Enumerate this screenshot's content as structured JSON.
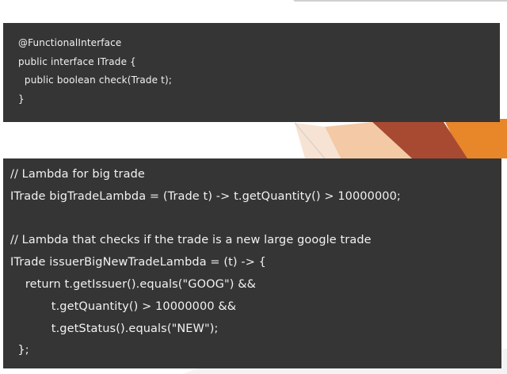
{
  "snippet_interface": {
    "lines": [
      "@FunctionalInterface",
      "public interface ITrade {",
      "  public boolean check(Trade t);",
      "}"
    ]
  },
  "snippet_lambdas": {
    "lines": [
      "// Lambda for big trade",
      "ITrade bigTradeLambda = (Trade t) -> t.getQuantity() > 10000000;",
      "",
      "// Lambda that checks if the trade is a new large google trade",
      "ITrade issuerBigNewTradeLambda = (t) -> {",
      "    return t.getIssuer().equals(\"GOOG\") &&",
      "           t.getQuantity() > 10000000 &&",
      "           t.getStatus().equals(\"NEW\");",
      "  };"
    ]
  },
  "colors": {
    "code_background": "#353535",
    "code_text": "#f2f2f2",
    "accent_orange": "#e8862a",
    "accent_red": "#a84a32",
    "accent_peach": "#f4c9a6"
  }
}
